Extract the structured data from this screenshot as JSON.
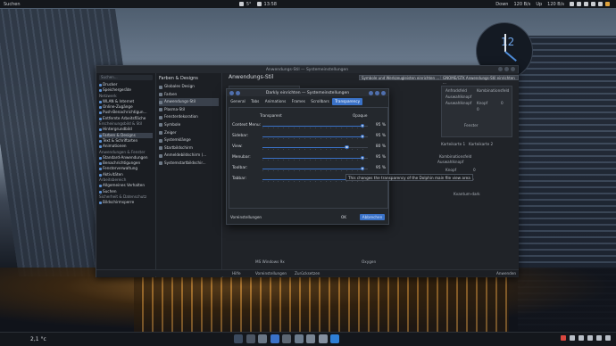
{
  "top_panel": {
    "left_label": "Suchen",
    "weather": "5°",
    "time": "13:58",
    "net_down": "Down",
    "net_down_rate": "120 B/s",
    "net_up": "Up",
    "net_up_rate": "120 B/s"
  },
  "clock_widget": {
    "number": "12"
  },
  "window": {
    "title": "Anwendungs-Stil — Systemeinstellungen",
    "sidebar": {
      "search": "Suchen...",
      "items": [
        {
          "label": "Drucker"
        },
        {
          "label": "Speichergeräte"
        },
        {
          "label": "Netzwerk",
          "header": true
        },
        {
          "label": "WLAN & Internet"
        },
        {
          "label": "Online-Zugänge"
        },
        {
          "label": "Push-Benachrichtigun..."
        },
        {
          "label": "Entfernte Arbeitsfläche"
        },
        {
          "label": "Erscheinungsbild & Stil",
          "header": true
        },
        {
          "label": "Hintergrundbild"
        },
        {
          "label": "Farben & Designs",
          "selected": true
        },
        {
          "label": "Text & Schriftarten"
        },
        {
          "label": "Animationen"
        },
        {
          "label": "Anwendungen & Fenster",
          "header": true
        },
        {
          "label": "Standard-Anwendungen"
        },
        {
          "label": "Benachrichtigungen"
        },
        {
          "label": "Fensterverwaltung"
        },
        {
          "label": "Aktivitäten"
        },
        {
          "label": "Arbeitsbereich",
          "header": true
        },
        {
          "label": "Allgemeines Verhalten"
        },
        {
          "label": "Suchen"
        },
        {
          "label": "Sicherheit & Datenschutz",
          "header": true
        },
        {
          "label": "Bildschirmsperre"
        }
      ]
    },
    "col2": {
      "header": "Farben & Designs",
      "items": [
        {
          "label": "Globales Design"
        },
        {
          "label": "Farben"
        },
        {
          "label": "Anwendungs-Stil",
          "selected": true
        },
        {
          "label": "Plasma-Stil"
        },
        {
          "label": "Fensterdekoration"
        },
        {
          "label": "Symbole"
        },
        {
          "label": "Zeiger"
        },
        {
          "label": "Systemklänge"
        },
        {
          "label": "Startbildschirm"
        },
        {
          "label": "Anmeldebildschirm (..."
        },
        {
          "label": "Systemstartbildschir..."
        }
      ]
    },
    "main": {
      "header": "Anwendungs-Stil",
      "toolbar_btn1": "Symbole und Werkzeugleisten einrichten ...",
      "toolbar_btn2": "GNOME/GTK Anwendungs-Stil einrichten ...",
      "preview_labels": {
        "inputfield": "Anfrodsfeld",
        "combobox": "Kombinationsfeld",
        "selectbox": "Auswahlknopf",
        "selectbox2": "Auswahlknopf",
        "button": "Knopf",
        "percent": "70 %",
        "spin": "0",
        "zero": "0",
        "frame": "Fenster",
        "tab1": "Karteikarte 1",
        "tab2": "Karteikarte 2",
        "combo2": "Kombinationsfeld",
        "radio": "Auswahlknopf",
        "btn2": "Knopf",
        "spin2": "0",
        "percent2": "70 %",
        "style_name1": "Kvantum-dark",
        "style_name2": "MS Windows 9x",
        "style_name3": "Oxygen"
      },
      "bottom": {
        "help": "Hilfe",
        "defaults": "Voreinstellungen",
        "reset": "Zurücksetzen",
        "apply": "Anwenden"
      }
    }
  },
  "dialog": {
    "title": "Darkly einrichten — Systemeinstellungen",
    "tabs": [
      {
        "label": "General"
      },
      {
        "label": "Tabs"
      },
      {
        "label": "Animations"
      },
      {
        "label": "Frames"
      },
      {
        "label": "Scrollbars"
      },
      {
        "label": "Transparency",
        "active": true
      }
    ],
    "legend_left": "Transparent",
    "legend_right": "Opaque",
    "sliders": [
      {
        "label": "Context Menu:",
        "value_text": "95 %",
        "value": 95
      },
      {
        "label": "Sidebar:",
        "value_text": "95 %",
        "value": 95
      },
      {
        "label": "View:",
        "value_text": "80 %",
        "value": 80
      },
      {
        "label": "Menubar:",
        "value_text": "95 %",
        "value": 95
      },
      {
        "label": "Toolbar:",
        "value_text": "95 %",
        "value": 95
      },
      {
        "label": "Tabbar:",
        "value_text": "100 %",
        "value": 100
      }
    ],
    "tooltip": "This changes the transparency of the Dolphin main file view area",
    "defaults_label": "Voreinstellungen",
    "ok_label": "OK",
    "cancel_label": "Abbrechen"
  },
  "taskbar": {
    "temp": "2,1 °c"
  },
  "colors": {
    "accent": "#3a72c8",
    "panel": "#14171c",
    "window_bg": "#1e2126"
  }
}
